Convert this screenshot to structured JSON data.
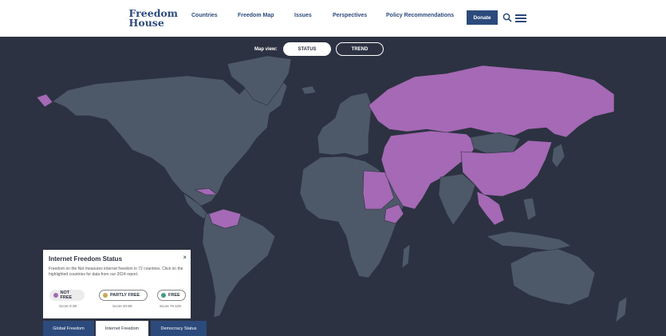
{
  "header": {
    "logo": {
      "line1": "Freedom",
      "line2": "House"
    },
    "nav": [
      "Countries",
      "Freedom Map",
      "Issues",
      "Perspectives",
      "Policy Recommendations"
    ],
    "donate_label": "Donate",
    "icons": [
      "search-icon",
      "menu-icon"
    ]
  },
  "map_view": {
    "label": "Map view:",
    "options": [
      "STATUS",
      "TREND"
    ],
    "selected": "STATUS"
  },
  "colors": {
    "background": "#2c3241",
    "land": "#4d5869",
    "not_free": "#a569b5",
    "partly_free": "#c8a950",
    "free": "#3f9c86",
    "brand": "#2c4a7c"
  },
  "legend": {
    "title": "Internet Freedom Status",
    "close": "×",
    "description": "Freedom on the Net measures internet freedom in 72 countries. Click on the highlighted countries for data from our 2024 report.",
    "categories": [
      {
        "label": "NOT FREE",
        "score": "Score 0-39"
      },
      {
        "label": "PARTLY FREE",
        "score": "Score 40-69"
      },
      {
        "label": "FREE",
        "score": "Score 70-100"
      }
    ]
  },
  "tabs": [
    "Global Freedom",
    "Internet Freedom",
    "Democracy Status"
  ],
  "selected_tab": "Internet Freedom"
}
